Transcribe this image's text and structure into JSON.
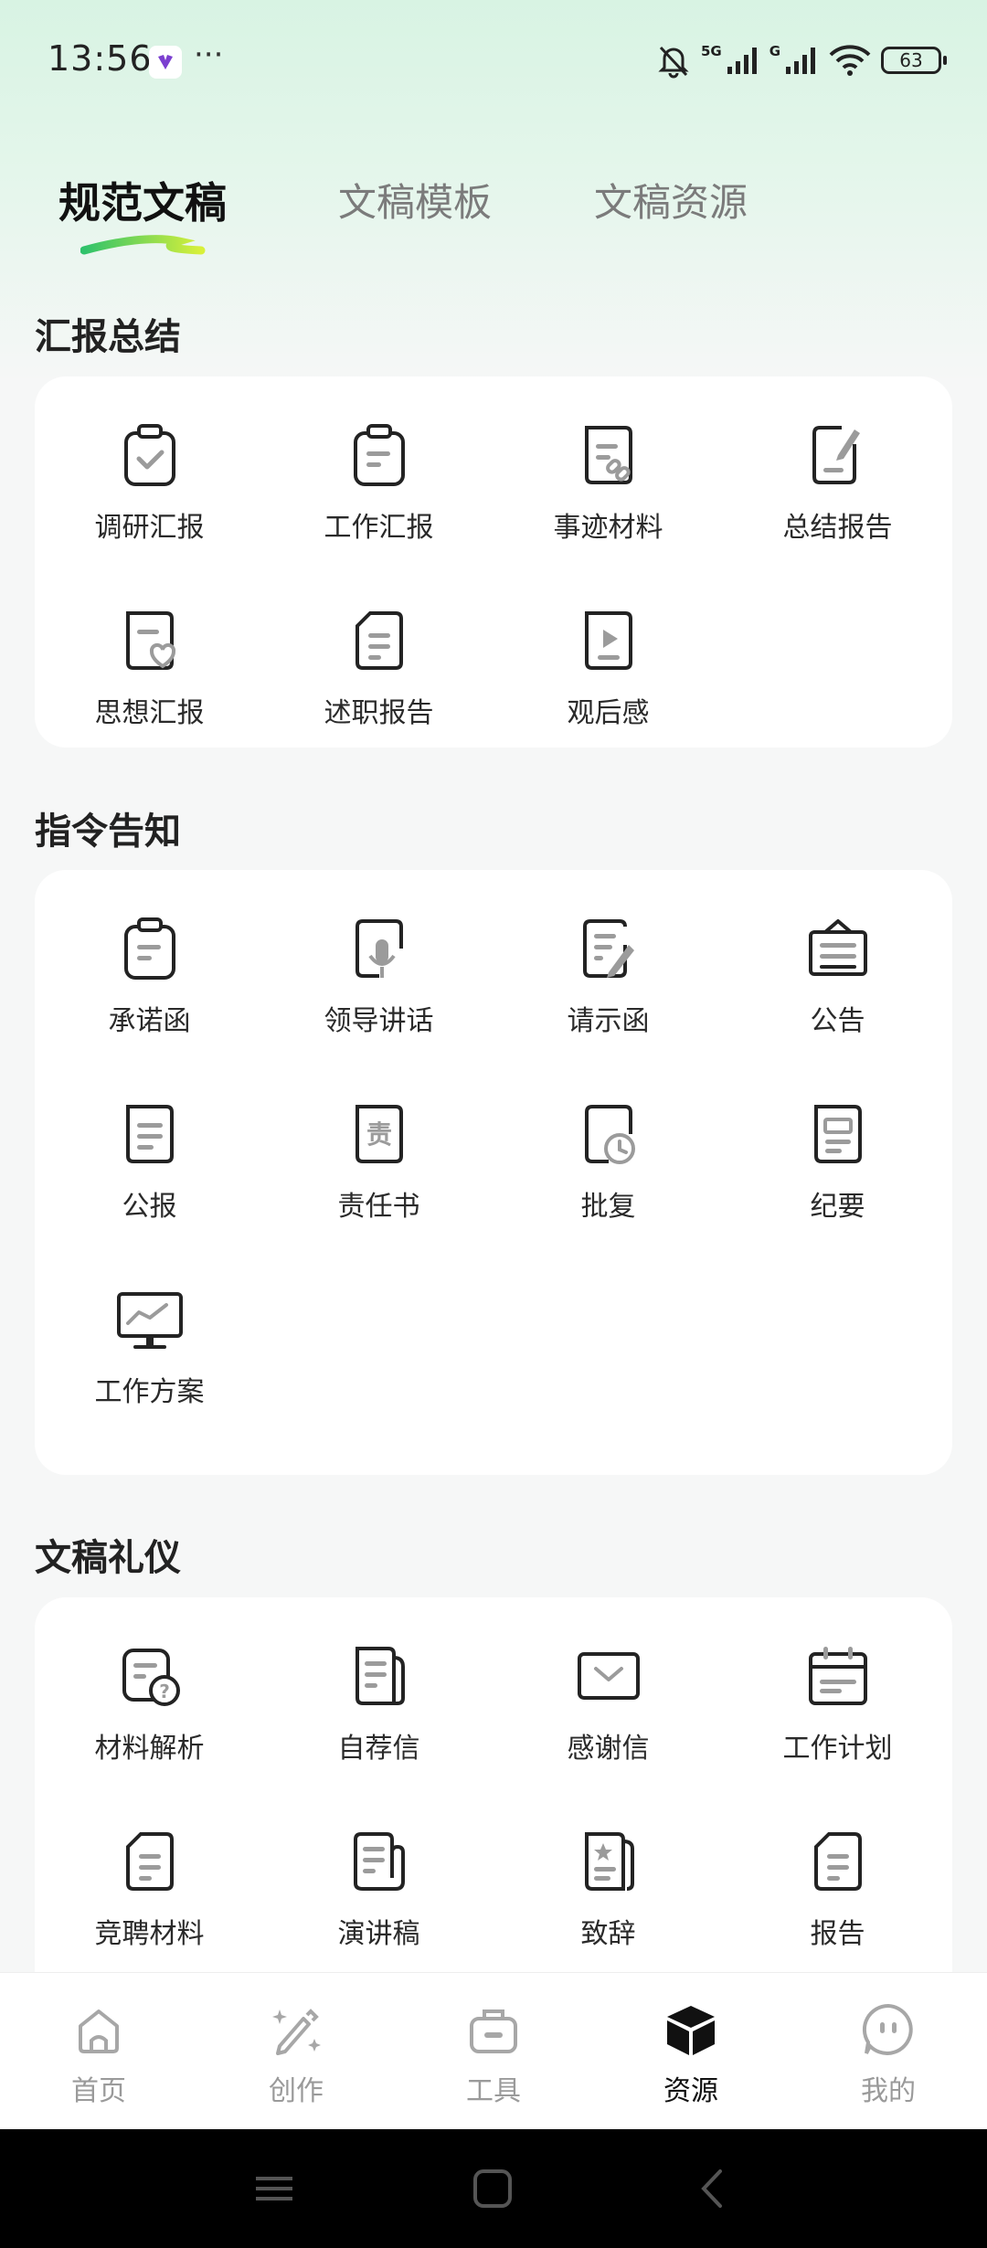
{
  "status_bar": {
    "time": "13:56",
    "more": "···",
    "net_5g": "5G",
    "net_g": "G",
    "battery": "63"
  },
  "tabs": [
    {
      "label": "规范文稿",
      "active": true
    },
    {
      "label": "文稿模板",
      "active": false
    },
    {
      "label": "文稿资源",
      "active": false
    }
  ],
  "sections": [
    {
      "title": "汇报总结",
      "items": [
        {
          "label": "调研汇报",
          "icon": "clipboard-check-icon"
        },
        {
          "label": "工作汇报",
          "icon": "clipboard-lines-icon"
        },
        {
          "label": "事迹材料",
          "icon": "doc-link-icon"
        },
        {
          "label": "总结报告",
          "icon": "doc-pen-icon"
        },
        {
          "label": "思想汇报",
          "icon": "doc-heart-icon"
        },
        {
          "label": "述职报告",
          "icon": "doc-fold-icon"
        },
        {
          "label": "观后感",
          "icon": "doc-play-icon"
        }
      ]
    },
    {
      "title": "指令告知",
      "items": [
        {
          "label": "承诺函",
          "icon": "clipboard-lines-icon"
        },
        {
          "label": "领导讲话",
          "icon": "microphone-doc-icon"
        },
        {
          "label": "请示函",
          "icon": "doc-edit-icon"
        },
        {
          "label": "公告",
          "icon": "notice-board-icon"
        },
        {
          "label": "公报",
          "icon": "doc-lines-icon"
        },
        {
          "label": "责任书",
          "icon": "responsibility-doc-icon",
          "glyph": "责"
        },
        {
          "label": "批复",
          "icon": "doc-clock-icon"
        },
        {
          "label": "纪要",
          "icon": "doc-box-icon"
        },
        {
          "label": "工作方案",
          "icon": "monitor-chart-icon"
        }
      ]
    },
    {
      "title": "文稿礼仪",
      "items": [
        {
          "label": "材料解析",
          "icon": "doc-question-icon"
        },
        {
          "label": "自荐信",
          "icon": "doc-stack-icon"
        },
        {
          "label": "感谢信",
          "icon": "envelope-icon"
        },
        {
          "label": "工作计划",
          "icon": "calendar-icon"
        },
        {
          "label": "竞聘材料",
          "icon": "doc-fold-icon"
        },
        {
          "label": "演讲稿",
          "icon": "scroll-icon"
        },
        {
          "label": "致辞",
          "icon": "doc-star-icon"
        },
        {
          "label": "报告",
          "icon": "doc-fold-icon"
        }
      ]
    }
  ],
  "bottom_nav": [
    {
      "label": "首页",
      "icon": "home-icon"
    },
    {
      "label": "创作",
      "icon": "magic-pen-icon"
    },
    {
      "label": "工具",
      "icon": "toolbox-icon"
    },
    {
      "label": "资源",
      "icon": "cube-icon",
      "active": true
    },
    {
      "label": "我的",
      "icon": "face-icon"
    }
  ]
}
